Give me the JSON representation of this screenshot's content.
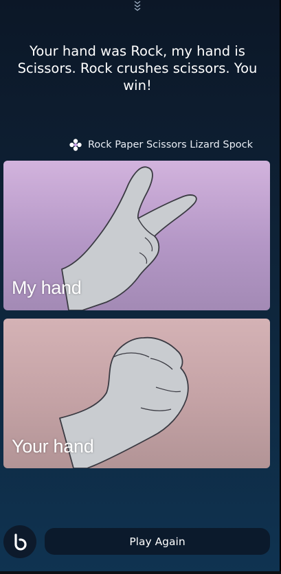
{
  "message": "Your hand was Rock, my hand is Scissors. Rock crushes scissors. You win!",
  "app": {
    "name": "Rock Paper Scissors Lizard Spock",
    "icon": "dots-cluster-icon"
  },
  "cards": {
    "my_hand": {
      "label": "My hand",
      "gesture": "scissors",
      "color": "#b497c6"
    },
    "your_hand": {
      "label": "Your hand",
      "gesture": "rock",
      "color": "#c4a2a5"
    }
  },
  "actions": {
    "play_again_label": "Play Again",
    "assistant_icon": "bixby-icon"
  },
  "colors": {
    "background_top": "#0c1727",
    "background_bottom": "#0f3351",
    "hand_fill": "#c9ccd0"
  }
}
